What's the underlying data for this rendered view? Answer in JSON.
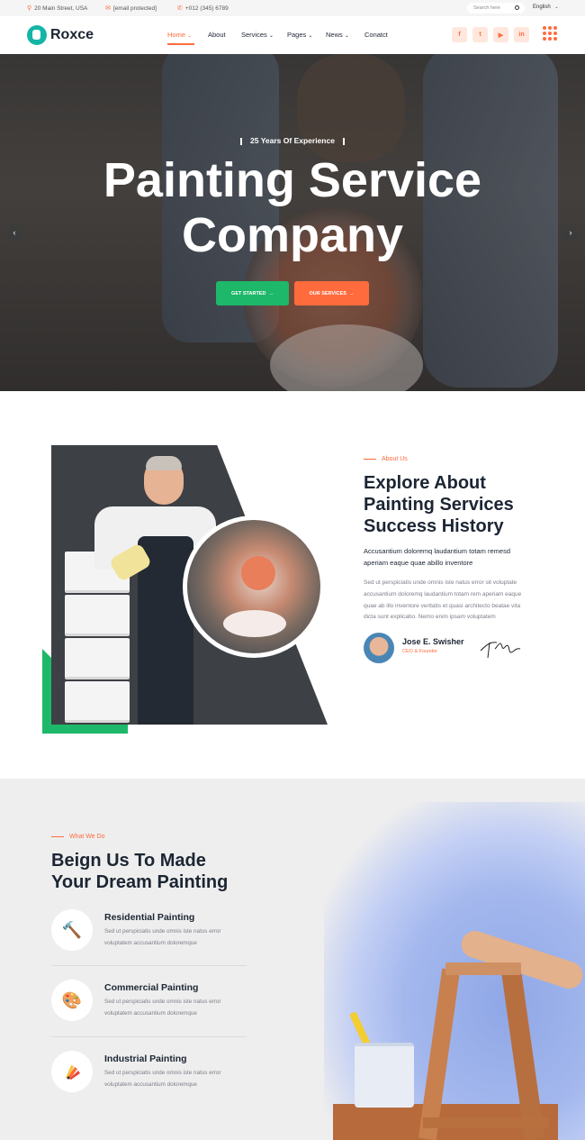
{
  "topbar": {
    "address": "20 Main Street, USA",
    "email": "[email protected]",
    "phone": "+012 (345) 6789",
    "search_placeholder": "Search here",
    "language": "English"
  },
  "header": {
    "logo_text": "Roxce",
    "nav": [
      "Home",
      "About",
      "Services",
      "Pages",
      "News",
      "Conatct"
    ],
    "social": [
      "facebook-icon",
      "twitter-icon",
      "youtube-icon",
      "linkedin-icon"
    ],
    "social_glyphs": [
      "f",
      "t",
      "▶",
      "in"
    ]
  },
  "hero": {
    "subtitle": "25 Years Of Experience",
    "title_line1": "Painting Service",
    "title_line2": "Company",
    "btn_primary": "GET STARTED",
    "btn_secondary": "OUR SERVICES"
  },
  "about": {
    "tag": "About Us",
    "heading_line1": "Explore About",
    "heading_line2": "Painting Services",
    "heading_line3": "Success History",
    "lead_line1": "Accusantium doloremq laudantium totam remesd",
    "lead_line2": "aperiam eaque quae abillo inventore",
    "para_lines": [
      "Sed ut perspiciatis unde omnis iste natus error sit voluptate",
      "accusantium doloremq laudantium totam rem aperiam eaque",
      "quae ab illo inventore veritatis et quasi architecto beatae vita",
      "dicta sunt explicabo. Nemo enim ipsam voluptatem"
    ],
    "person_name": "Jose E. Swisher",
    "person_role": "CEO & Founder"
  },
  "services": {
    "tag": "What We Do",
    "heading_line1": "Beign Us To Made",
    "heading_line2": "Your Dream Painting",
    "items": [
      {
        "title": "Residential Painting",
        "line1": "Sed ut perspiciatis unde omnis iste natus error",
        "line2": "voluptatem accusantium doloremque",
        "icon": "hammer-brush-icon"
      },
      {
        "title": "Commercial Painting",
        "line1": "Sed ut perspiciatis unde omnis iste natus error",
        "line2": "voluptatem accusantium doloremque",
        "icon": "palette-icon"
      },
      {
        "title": "Industrial Painting",
        "line1": "Sed ut perspiciatis unde omnis iste natus error",
        "line2": "voluptatem accusantium doloremque",
        "icon": "color-swatch-icon"
      }
    ]
  },
  "colors": {
    "accent": "#ff6b3d",
    "green": "#1db869",
    "dark": "#1c2533"
  }
}
